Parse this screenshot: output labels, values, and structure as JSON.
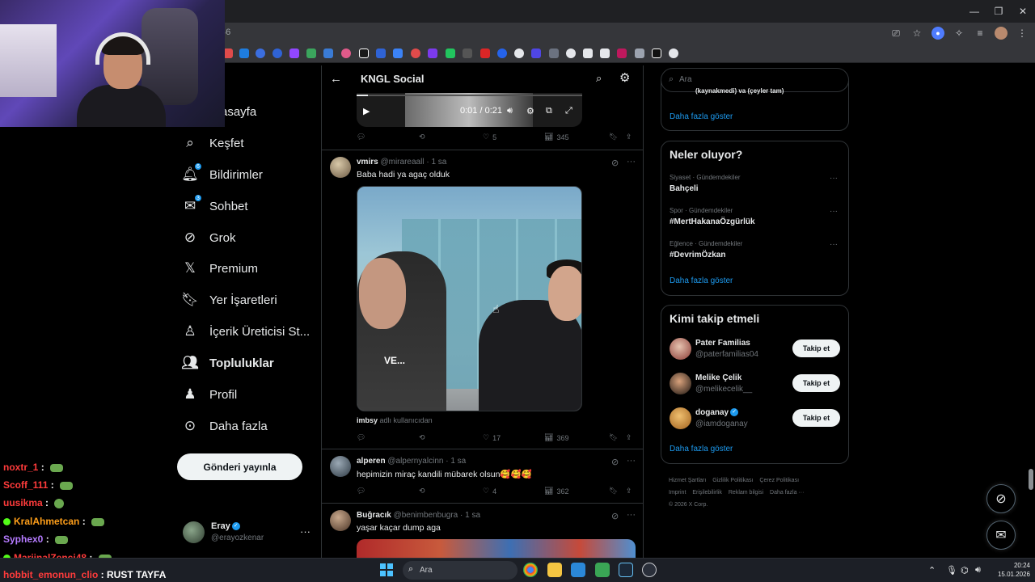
{
  "browser": {
    "url_fragment": "/46"
  },
  "nav": {
    "items": [
      {
        "label": "Anasayfa",
        "icon": "home-icon"
      },
      {
        "label": "Keşfet",
        "icon": "search-icon"
      },
      {
        "label": "Bildirimler",
        "icon": "bell-icon",
        "badge": "6"
      },
      {
        "label": "Sohbet",
        "icon": "mail-icon",
        "badge": "3"
      },
      {
        "label": "Grok",
        "icon": "grok-icon"
      },
      {
        "label": "Premium",
        "icon": "x-logo-icon"
      },
      {
        "label": "Yer İşaretleri",
        "icon": "bookmark-icon"
      },
      {
        "label": "İçerik Üreticisi St...",
        "icon": "creator-icon"
      },
      {
        "label": "Topluluklar",
        "icon": "communities-icon"
      },
      {
        "label": "Profil",
        "icon": "profile-icon"
      },
      {
        "label": "Daha fazla",
        "icon": "more-circle-icon"
      }
    ],
    "nav_visible_partial": "asayfa",
    "post_button": "Gönderi yayınla",
    "account": {
      "name": "Eray",
      "handle": "@erayozkenar",
      "more": "···"
    }
  },
  "feed": {
    "title": "KNGL Social",
    "video": {
      "time": "0:01 / 0:21",
      "progress": 0.05
    },
    "first_actions": {
      "replies": "",
      "reposts": "",
      "likes": "5",
      "views": "345"
    },
    "tweets": [
      {
        "name": "vmirs",
        "handle": "@mirareaall",
        "time": "1 sa",
        "text": "Baba hadi ya agaç olduk",
        "media_caption": "VE...",
        "credit_user": "imbsy",
        "credit_text": "adlı kullanıcıdan",
        "likes": "17",
        "views": "369"
      },
      {
        "name": "alperen",
        "handle": "@alpernyalcinn",
        "time": "1 sa",
        "text": "hepimizin miraç kandili mübarek olsun🥰🥰🥰",
        "likes": "4",
        "views": "362"
      },
      {
        "name": "Buğracık",
        "handle": "@benimbenbugra",
        "time": "1 sa",
        "text": "yaşar kaçar dump aga"
      }
    ]
  },
  "right": {
    "search_placeholder": "Ara",
    "top_more": "Daha fazla göster",
    "partial_text": "(kaynakmedi) va (çeyler tam)",
    "trends_title": "Neler oluyor?",
    "trends": [
      {
        "category": "Siyaset · Gündemdekiler",
        "name": "Bahçeli"
      },
      {
        "category": "Spor · Gündemdekiler",
        "name": "#MertHakanaÖzgürlük"
      },
      {
        "category": "Eğlence · Gündemdekiler",
        "name": "#DevrimÖzkan"
      }
    ],
    "trends_more": "Daha fazla göster",
    "wtf_title": "Kimi takip etmeli",
    "wtf": [
      {
        "name": "Pater Familias",
        "handle": "@paterfamilias04",
        "verified": false
      },
      {
        "name": "Melike Çelik",
        "handle": "@melikecelik__",
        "verified": false
      },
      {
        "name": "doganay",
        "handle": "@iamdoganay",
        "verified": true
      }
    ],
    "follow_label": "Takip et",
    "wtf_more": "Daha fazla göster",
    "footer": [
      "Hizmet Şartları",
      "Gizlilik Politikası",
      "Çerez Politikası",
      "Imprint",
      "Erişilebilirlik",
      "Reklam bilgisi",
      "Daha fazla ···",
      "© 2026 X Corp."
    ]
  },
  "chat": [
    {
      "user": "noxtr_1",
      "color": "#ff3b3b",
      "msg": ""
    },
    {
      "user": "Scoff_111",
      "color": "#ff3b3b",
      "msg": ""
    },
    {
      "user": "uusikma",
      "color": "#ff3b3b",
      "msg": ""
    },
    {
      "user": "KralAhmetcan",
      "color": "#ff9f1a",
      "msg": ""
    },
    {
      "user": "Syphex0",
      "color": "#b57bff",
      "msg": ""
    },
    {
      "user": "MarjinalZenci48",
      "color": "#ff3b3b",
      "msg": ""
    },
    {
      "user": "hobbit_emonun_clio",
      "color": "#ff3b3b",
      "msg": "RUST TAYFA"
    }
  ],
  "taskbar": {
    "search_placeholder": "Ara",
    "time": "20:24",
    "date": "15.01.2026"
  }
}
